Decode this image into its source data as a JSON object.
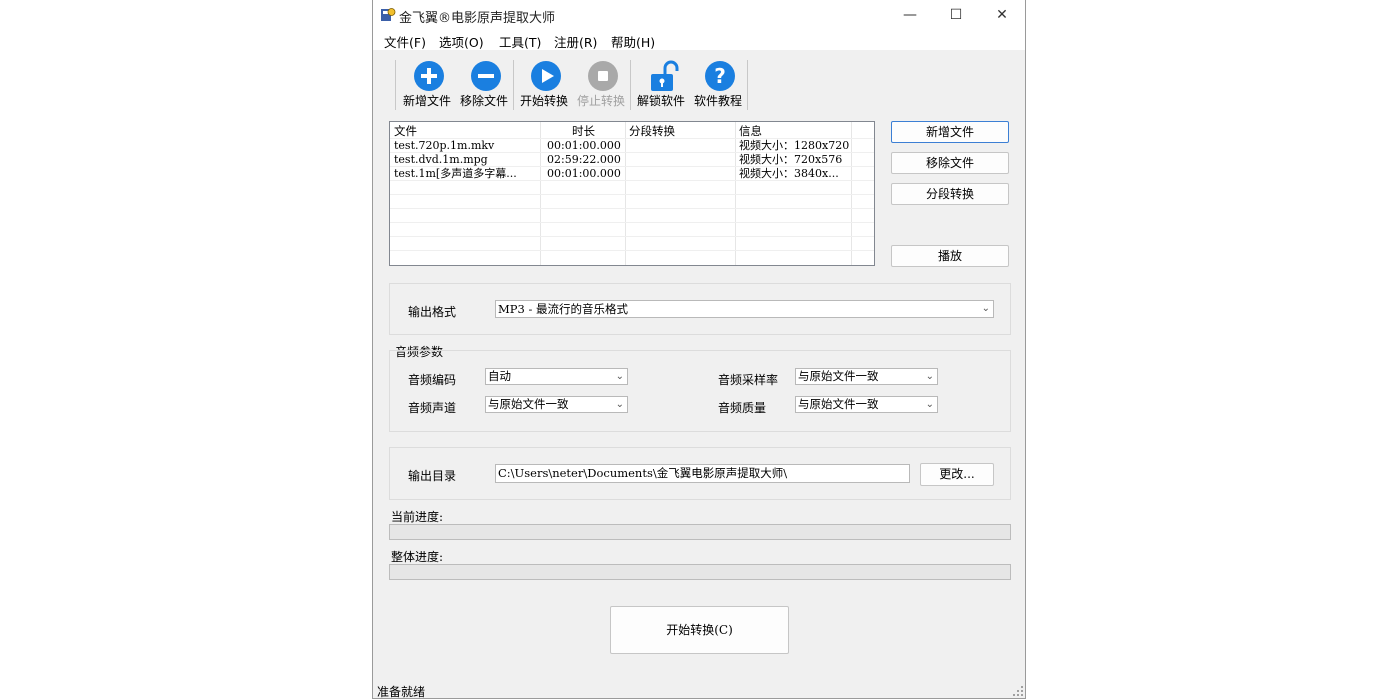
{
  "window": {
    "title": "金飞翼®电影原声提取大师",
    "controls": {
      "minimize": "—",
      "maximize": "☐",
      "close": "✕"
    }
  },
  "menu": [
    "文件(F)",
    "选项(O)",
    "工具(T)",
    "注册(R)",
    "帮助(H)"
  ],
  "toolbar": {
    "add_file": "新增文件",
    "remove_file": "移除文件",
    "start_convert": "开始转换",
    "stop_convert": "停止转换",
    "unlock": "解锁软件",
    "tutorial": "软件教程"
  },
  "file_list": {
    "columns": [
      "文件",
      "时长",
      "分段转换",
      "信息"
    ],
    "rows": [
      {
        "file": "test.720p.1m.mkv",
        "duration": "00:01:00.000",
        "segment": "",
        "info": "视频大小：1280x720"
      },
      {
        "file": "test.dvd.1m.mpg",
        "duration": "02:59:22.000",
        "segment": "",
        "info": "视频大小：720x576"
      },
      {
        "file": "test.1m[多声道多字幕...",
        "duration": "00:01:00.000",
        "segment": "",
        "info": "视频大小：3840x..."
      }
    ]
  },
  "side_buttons": {
    "add_file": "新增文件",
    "remove_file": "移除文件",
    "segment_convert": "分段转换",
    "play": "播放"
  },
  "output_format": {
    "label": "输出格式",
    "value": "MP3 - 最流行的音乐格式"
  },
  "audio_params": {
    "group_title": "音频参数",
    "codec_label": "音频编码",
    "codec_value": "自动",
    "channel_label": "音频声道",
    "channel_value": "与原始文件一致",
    "samplerate_label": "音频采样率",
    "samplerate_value": "与原始文件一致",
    "quality_label": "音频质量",
    "quality_value": "与原始文件一致"
  },
  "output_dir": {
    "label": "输出目录",
    "value": "C:\\Users\\neter\\Documents\\金飞翼电影原声提取大师\\",
    "change_button": "更改..."
  },
  "progress": {
    "current_label": "当前进度:",
    "current_value": 0,
    "overall_label": "整体进度:",
    "overall_value": 0
  },
  "start_button": "开始转换(C)",
  "status": "准备就绪",
  "colors": {
    "toolbar_icon_blue": "#1a7fe0",
    "toolbar_icon_disabled": "#a9a9a9",
    "default_button_border": "#3c7fd4"
  }
}
